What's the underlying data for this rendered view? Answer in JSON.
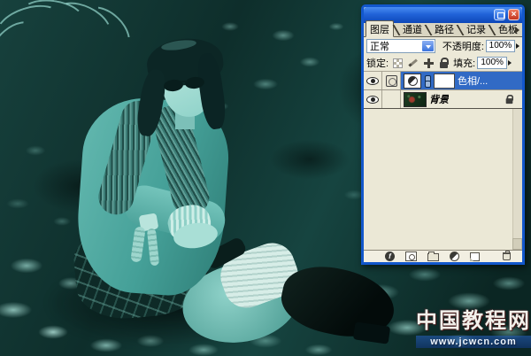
{
  "palette": {
    "tabs": [
      {
        "label": "图层",
        "active": true
      },
      {
        "label": "通道",
        "active": false
      },
      {
        "label": "路径",
        "active": false
      },
      {
        "label": "记录",
        "active": false
      },
      {
        "label": "色板",
        "active": false
      }
    ],
    "blend_mode_value": "正常",
    "opacity_label": "不透明度:",
    "opacity_value": "100%",
    "lock_label": "锁定:",
    "fill_label": "填充:",
    "fill_value": "100%",
    "layers": [
      {
        "name": "色相/...",
        "selected": true,
        "type": "hue-saturation-adjustment"
      },
      {
        "name": "背景",
        "selected": false,
        "locked": true
      }
    ]
  },
  "window": {
    "close_glyph": "×"
  },
  "watermark": {
    "line1": "中国教程网",
    "line2": "www.jcwcn.com"
  },
  "colors": {
    "selection_blue": "#316ac5",
    "palette_bg": "#ece9d8",
    "titlebar_blue": "#2163d8",
    "close_red": "#c23520",
    "photo_dark_teal": "#0e2e2b",
    "photo_light_teal": "#7cc8c0"
  }
}
